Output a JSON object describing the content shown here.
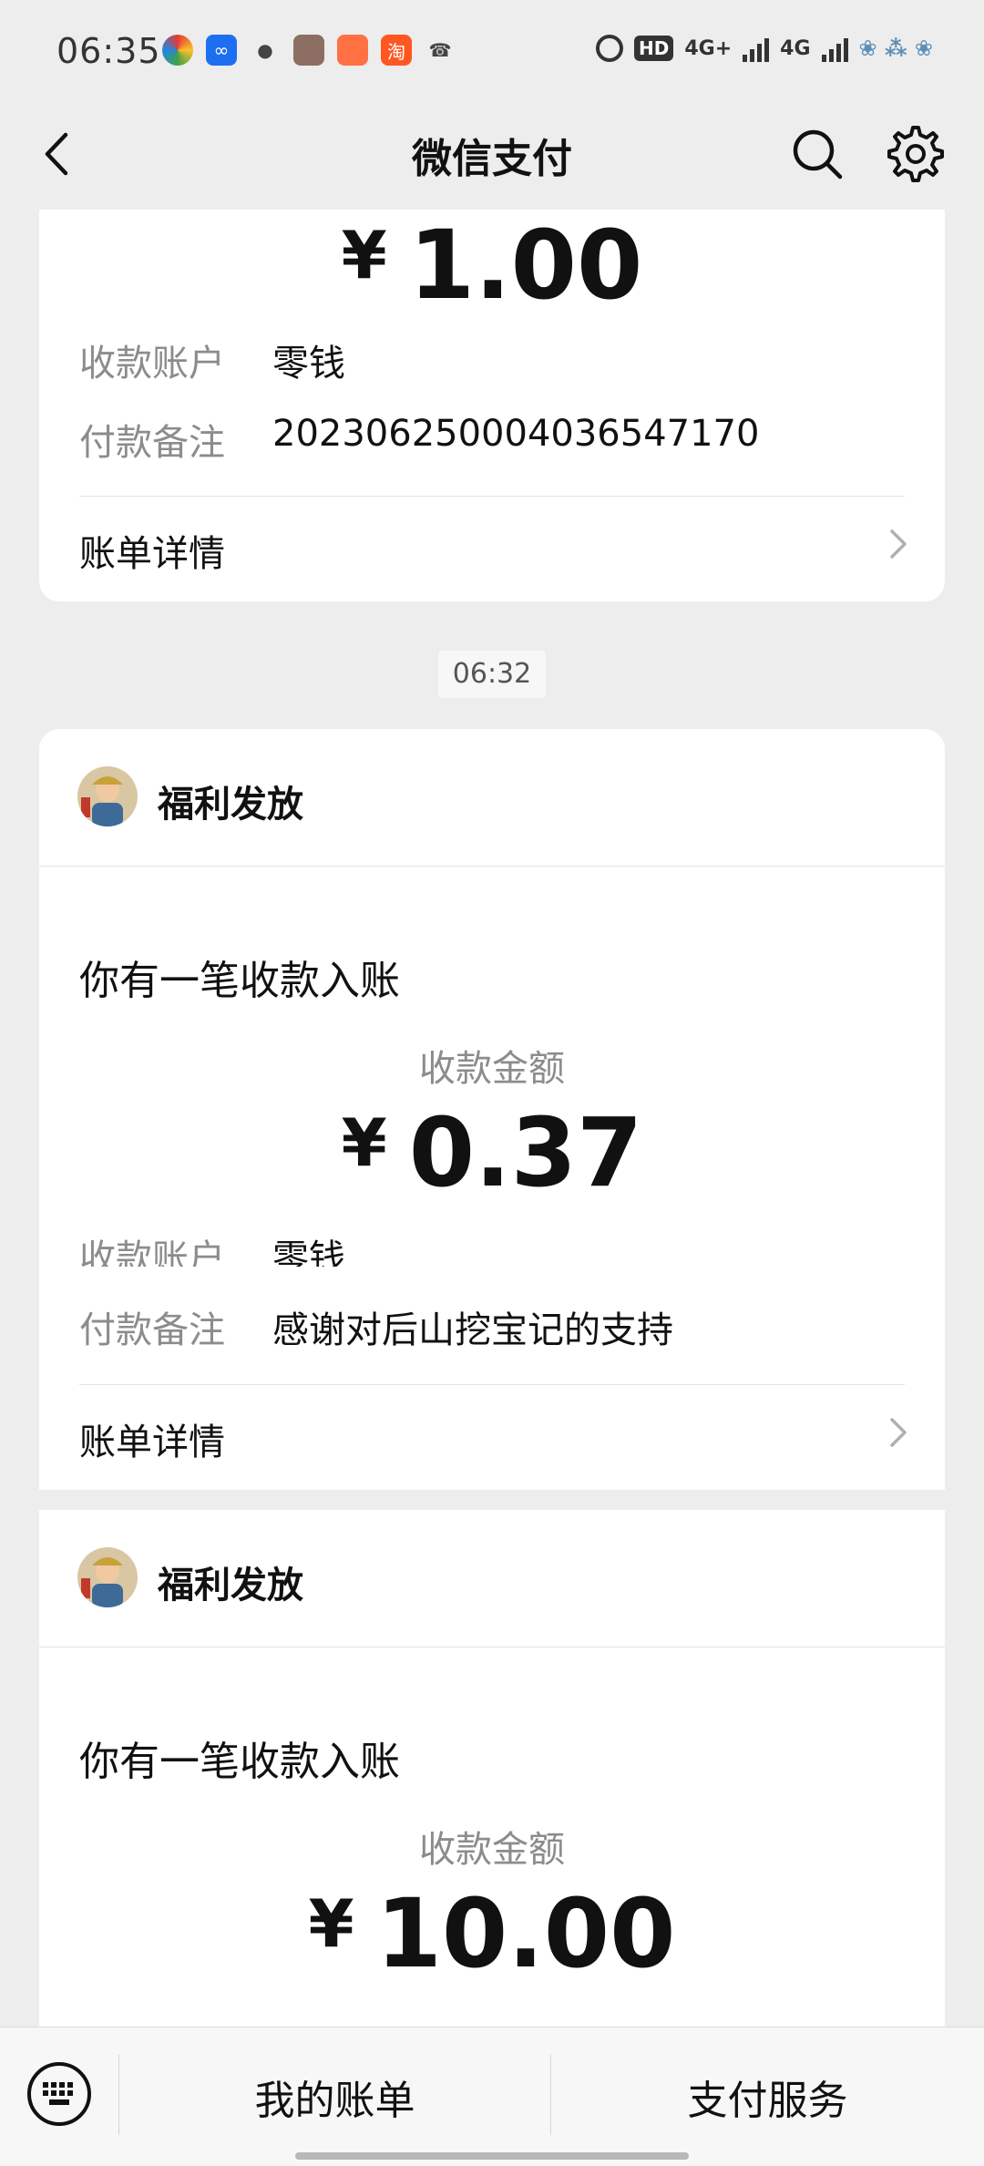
{
  "status_bar": {
    "time": "06:35",
    "right_text": [
      "HD",
      "4G+",
      "4G"
    ]
  },
  "nav": {
    "title": "微信支付",
    "back_icon": "chevron-left-icon",
    "search_icon": "search-icon",
    "settings_icon": "gear-icon"
  },
  "messages": [
    {
      "amount_yen": "¥",
      "amount": "1.00",
      "account_label": "收款账户",
      "account_value": "零钱",
      "remark_label": "付款备注",
      "remark_value": "202306250004036547170",
      "detail_label": "账单详情"
    },
    {
      "time": "06:32",
      "sender": "福利发放",
      "headline": "你有一笔收款入账",
      "amount_label": "收款金额",
      "amount_yen": "¥",
      "amount": "0.37",
      "account_label": "收款账户",
      "account_value": "零钱",
      "remark_label": "付款备注",
      "remark_value": "感谢对后山挖宝记的支持",
      "detail_label": "账单详情"
    },
    {
      "sender": "福利发放",
      "headline": "你有一笔收款入账",
      "amount_label": "收款金额",
      "amount_yen": "¥",
      "amount": "10.00"
    }
  ],
  "bottom_bar": {
    "keyboard_icon": "keyboard-icon",
    "my_bills": "我的账单",
    "pay_services": "支付服务"
  },
  "colors": {
    "background": "#ededed",
    "card": "#ffffff",
    "muted_text": "#8c8c8c"
  }
}
